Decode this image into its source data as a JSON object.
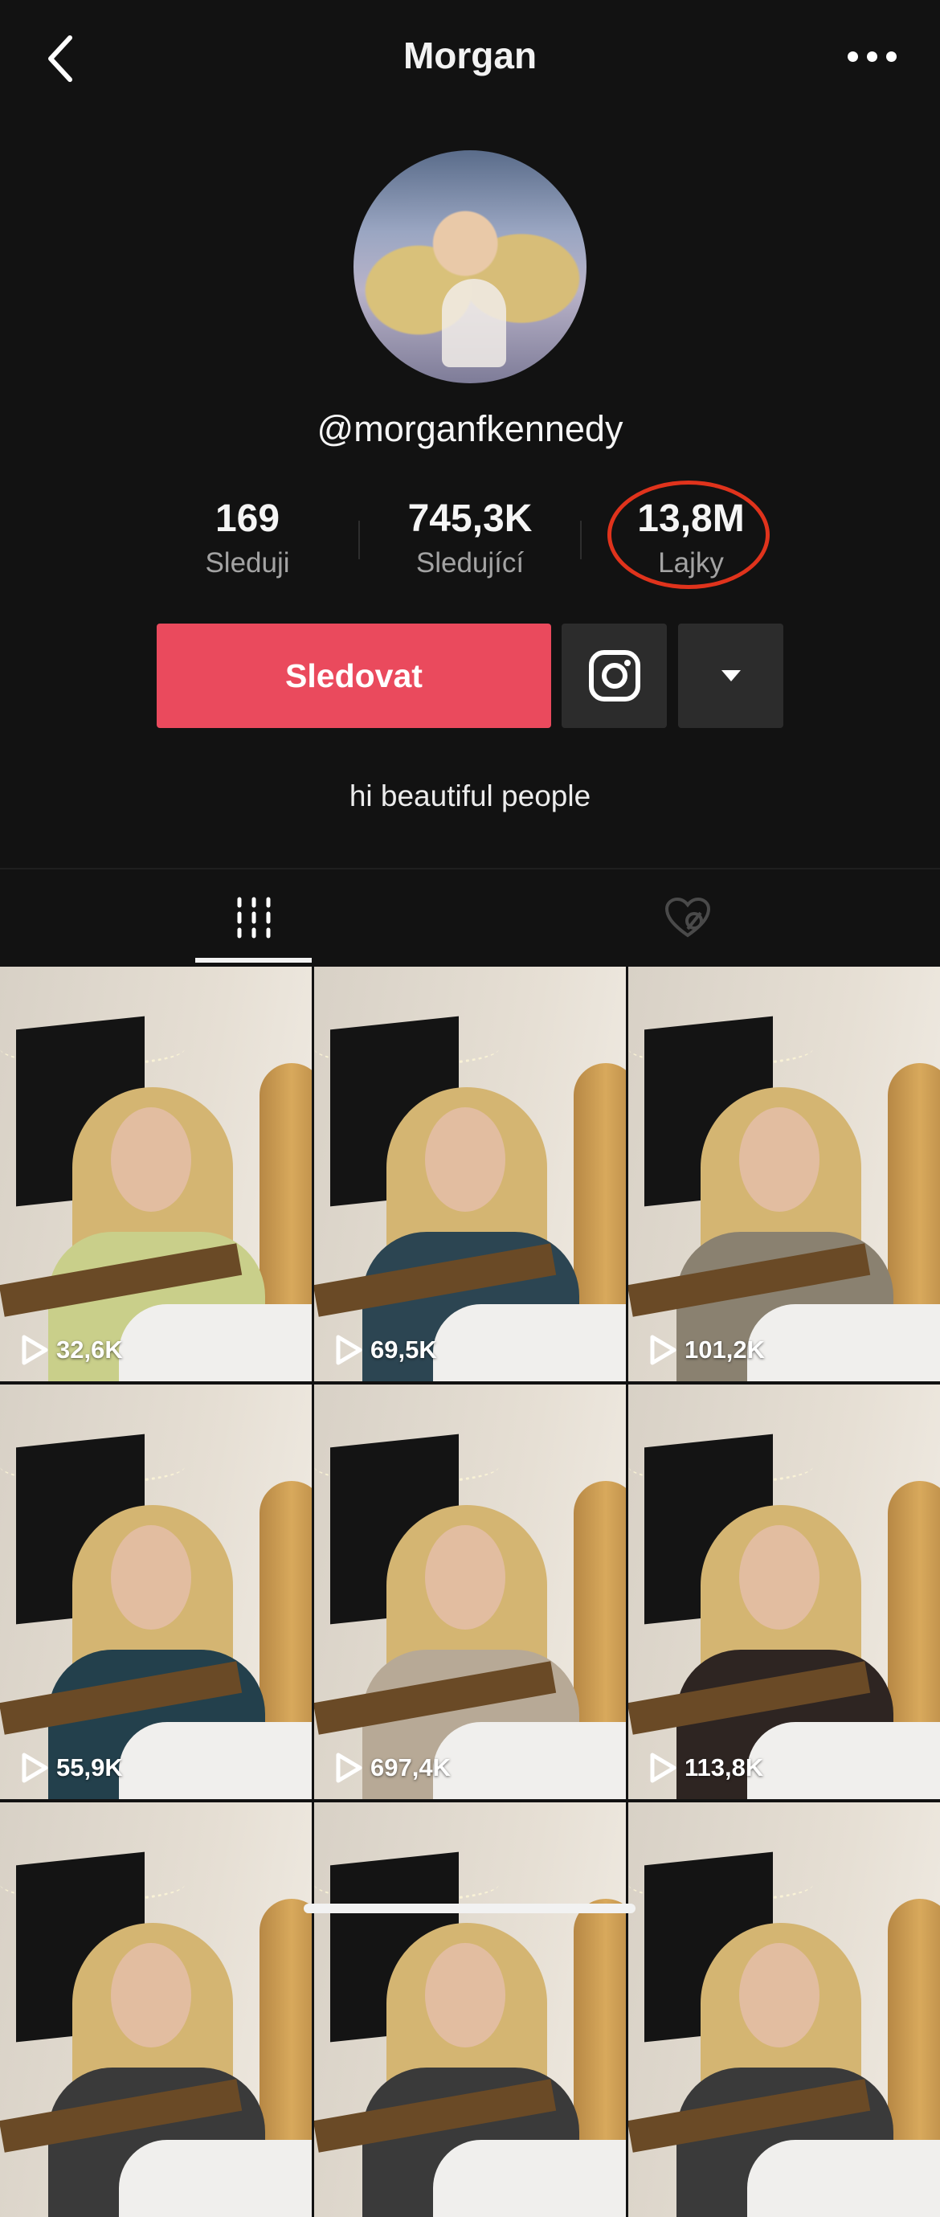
{
  "header": {
    "title": "Morgan",
    "back_icon": "chevron-left-icon",
    "more_icon": "more-horizontal-icon"
  },
  "profile": {
    "username": "@morganfkennedy",
    "bio": "hi beautiful people"
  },
  "stats": [
    {
      "value": "169",
      "label": "Sleduji"
    },
    {
      "value": "745,3K",
      "label": "Sledující"
    },
    {
      "value": "13,8M",
      "label": "Lajky"
    }
  ],
  "actions": {
    "follow_label": "Sledovat",
    "instagram_icon": "instagram-icon",
    "dropdown_icon": "caret-down-icon",
    "follow_color": "#ea4a5d"
  },
  "tabs": [
    {
      "name": "videos",
      "icon": "grid-bars-icon",
      "active": true
    },
    {
      "name": "liked",
      "icon": "heart-hidden-icon",
      "active": false
    }
  ],
  "videos": [
    {
      "views": "32,6K",
      "shirt": "#c9cf8a"
    },
    {
      "views": "69,5K",
      "shirt": "#2c4552"
    },
    {
      "views": "101,2K",
      "shirt": "#8a8170"
    },
    {
      "views": "55,9K",
      "shirt": "#23404c"
    },
    {
      "views": "697,4K",
      "shirt": "#b7a996"
    },
    {
      "views": "113,8K",
      "shirt": "#2e2522"
    },
    {
      "views": "",
      "shirt": "#3a3a3a"
    },
    {
      "views": "",
      "shirt": "#3a3a3a"
    },
    {
      "views": "",
      "shirt": "#3a3a3a"
    }
  ]
}
